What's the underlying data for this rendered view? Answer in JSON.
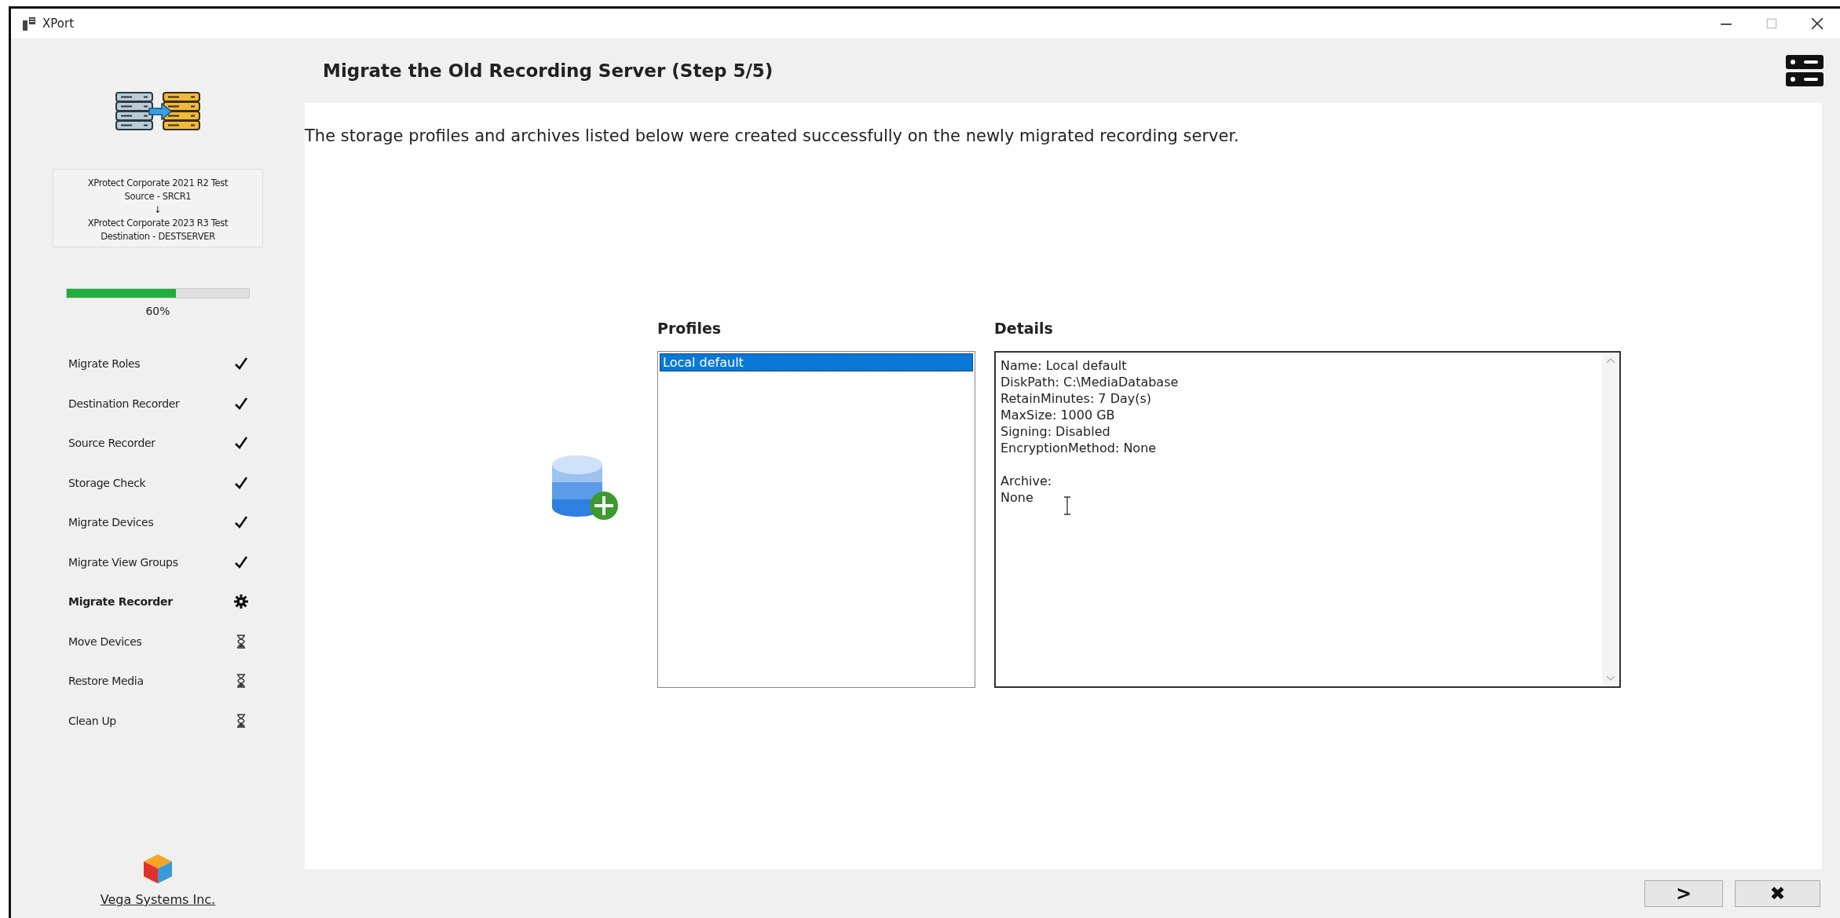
{
  "window": {
    "title": "XPort"
  },
  "sidebar": {
    "info": [
      "XProtect Corporate 2021 R2 Test",
      "Source - SRCR1",
      "↓",
      "XProtect Corporate 2023 R3 Test",
      "Destination - DESTSERVER"
    ],
    "progress": {
      "level": 0.6,
      "label": "60%"
    },
    "steps": [
      {
        "label": "Migrate Roles",
        "kind": "done"
      },
      {
        "label": "Destination Recorder",
        "kind": "done"
      },
      {
        "label": "Source Recorder",
        "kind": "done"
      },
      {
        "label": "Storage Check",
        "kind": "done"
      },
      {
        "label": "Migrate Devices",
        "kind": "done"
      },
      {
        "label": "Migrate View Groups",
        "kind": "done"
      },
      {
        "label": "Migrate Recorder",
        "kind": "current"
      },
      {
        "label": "Move Devices",
        "kind": "pending"
      },
      {
        "label": "Restore Media",
        "kind": "pending"
      },
      {
        "label": "Clean Up",
        "kind": "pending"
      }
    ],
    "company_link": "Vega Systems Inc."
  },
  "page": {
    "title": "Migrate the Old Recording Server (Step 5/5)",
    "description": "The storage profiles and archives listed below were created successfully on the newly migrated recording server.",
    "profiles": {
      "heading": "Profiles",
      "items": [
        {
          "label": "Local default",
          "selected": true
        }
      ]
    },
    "details": {
      "heading": "Details",
      "sections": [
        {
          "lines": [
            "Name: Local default",
            "DiskPath: C:\\MediaDatabase",
            "RetainMinutes: 7 Day(s)",
            "MaxSize: 1000 GB",
            "Signing: Disabled",
            "EncryptionMethod: None"
          ]
        },
        {
          "lines": [
            "Archive:",
            "None"
          ]
        }
      ]
    }
  },
  "buttons": [
    {
      "kind": "next",
      "label": ">"
    },
    {
      "kind": "cancel",
      "label": "✖"
    }
  ]
}
